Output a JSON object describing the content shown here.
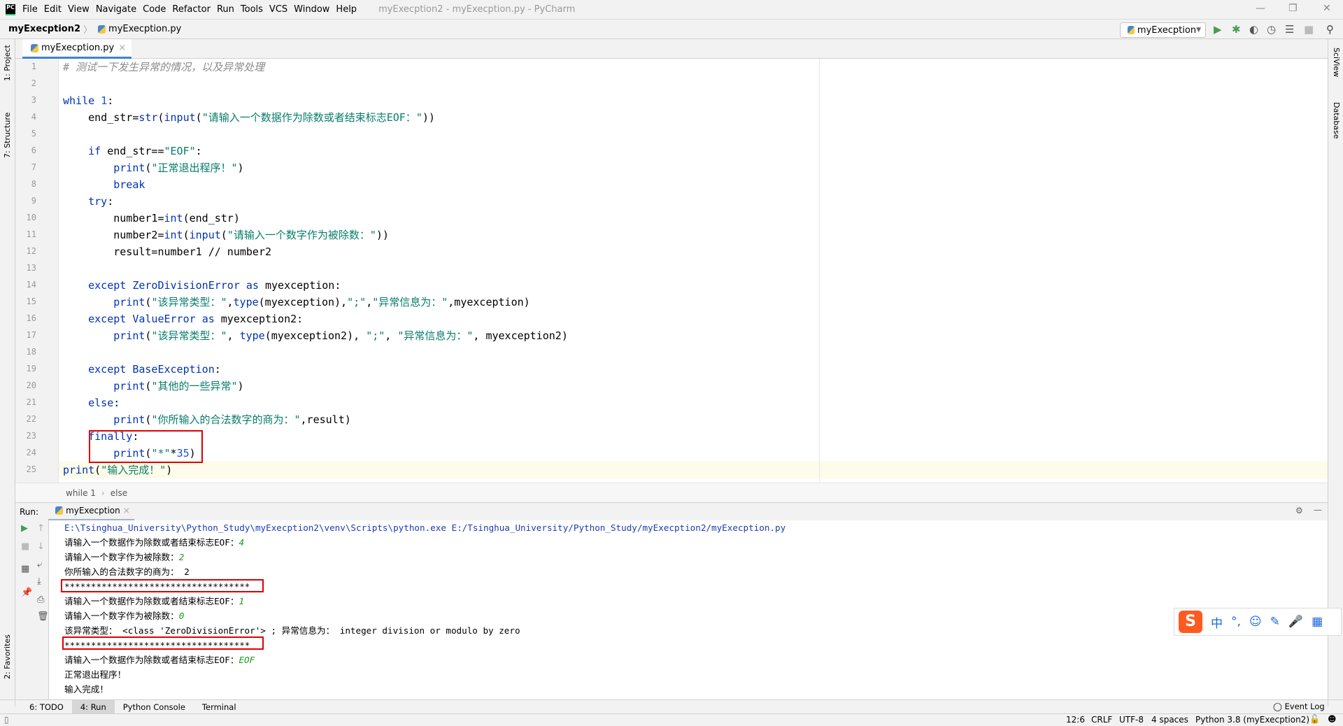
{
  "window": {
    "title": "myExecption2 - myExecption.py - PyCharm",
    "controls": [
      "—",
      "❐",
      "✕"
    ]
  },
  "menu": [
    "File",
    "Edit",
    "View",
    "Navigate",
    "Code",
    "Refactor",
    "Run",
    "Tools",
    "VCS",
    "Window",
    "Help"
  ],
  "nav": {
    "project": "myExecption2",
    "file": "myExecption.py"
  },
  "toolbar": {
    "run_config": "myExecption",
    "icons": [
      "run-icon",
      "debug-icon",
      "coverage-icon",
      "profile-icon",
      "concurrency-icon",
      "stop-icon",
      "search-icon"
    ]
  },
  "editor_tab": {
    "label": "myExecption.py"
  },
  "left_strip": {
    "project": "1: Project",
    "structure": "7: Structure",
    "favorites": "2: Favorites"
  },
  "right_strip": {
    "sciview": "SciView",
    "database": "Database"
  },
  "code": [
    [
      [
        "# 测试一下发生异常的情况，以及异常处理",
        "cm"
      ]
    ],
    [],
    [
      [
        "while ",
        "kw"
      ],
      [
        "1",
        "nm"
      ],
      [
        ":",
        "pl"
      ]
    ],
    [
      [
        "    end_str=",
        "pl"
      ],
      [
        "str",
        "bi"
      ],
      [
        "(",
        "pl"
      ],
      [
        "input",
        "bi"
      ],
      [
        "(",
        "pl"
      ],
      [
        "\"请输入一个数据作为除数或者结束标志EOF：\"",
        "st"
      ],
      [
        "))",
        "pl"
      ]
    ],
    [],
    [
      [
        "    ",
        "pl"
      ],
      [
        "if ",
        "kw"
      ],
      [
        "end_str==",
        "pl"
      ],
      [
        "\"EOF\"",
        "st"
      ],
      [
        ":",
        "pl"
      ]
    ],
    [
      [
        "        ",
        "pl"
      ],
      [
        "print",
        "bi"
      ],
      [
        "(",
        "pl"
      ],
      [
        "\"正常退出程序！\"",
        "st"
      ],
      [
        ")",
        "pl"
      ]
    ],
    [
      [
        "        ",
        "pl"
      ],
      [
        "break",
        "kw"
      ]
    ],
    [
      [
        "    ",
        "pl"
      ],
      [
        "try",
        "kw"
      ],
      [
        ":",
        "pl"
      ]
    ],
    [
      [
        "        number1=",
        "pl"
      ],
      [
        "int",
        "bi"
      ],
      [
        "(end_str)",
        "pl"
      ]
    ],
    [
      [
        "        number2=",
        "pl"
      ],
      [
        "int",
        "bi"
      ],
      [
        "(",
        "pl"
      ],
      [
        "input",
        "bi"
      ],
      [
        "(",
        "pl"
      ],
      [
        "\"请输入一个数字作为被除数：\"",
        "st"
      ],
      [
        "))",
        "pl"
      ]
    ],
    [
      [
        "        result=number1 // number2",
        "pl"
      ]
    ],
    [],
    [
      [
        "    ",
        "pl"
      ],
      [
        "except ",
        "kw"
      ],
      [
        "ZeroDivisionError ",
        "bi"
      ],
      [
        "as ",
        "kw"
      ],
      [
        "myexception:",
        "pl"
      ]
    ],
    [
      [
        "        ",
        "pl"
      ],
      [
        "print",
        "bi"
      ],
      [
        "(",
        "pl"
      ],
      [
        "\"该异常类型：\"",
        "st"
      ],
      [
        ",",
        "pl"
      ],
      [
        "type",
        "bi"
      ],
      [
        "(myexception),",
        "pl"
      ],
      [
        "\";\"",
        "st"
      ],
      [
        ",",
        "pl"
      ],
      [
        "\"异常信息为：\"",
        "st"
      ],
      [
        ",myexception)",
        "pl"
      ]
    ],
    [
      [
        "    ",
        "pl"
      ],
      [
        "except ",
        "kw"
      ],
      [
        "ValueError ",
        "bi"
      ],
      [
        "as ",
        "kw"
      ],
      [
        "myexception2:",
        "pl"
      ]
    ],
    [
      [
        "        ",
        "pl"
      ],
      [
        "print",
        "bi"
      ],
      [
        "(",
        "pl"
      ],
      [
        "\"该异常类型：\"",
        "st"
      ],
      [
        ", ",
        "pl"
      ],
      [
        "type",
        "bi"
      ],
      [
        "(myexception2), ",
        "pl"
      ],
      [
        "\";\"",
        "st"
      ],
      [
        ", ",
        "pl"
      ],
      [
        "\"异常信息为：\"",
        "st"
      ],
      [
        ", myexception2)",
        "pl"
      ]
    ],
    [],
    [
      [
        "    ",
        "pl"
      ],
      [
        "except ",
        "kw"
      ],
      [
        "BaseException",
        "bi"
      ],
      [
        ":",
        "pl"
      ]
    ],
    [
      [
        "        ",
        "pl"
      ],
      [
        "print",
        "bi"
      ],
      [
        "(",
        "pl"
      ],
      [
        "\"其他的一些异常\"",
        "st"
      ],
      [
        ")",
        "pl"
      ]
    ],
    [
      [
        "    ",
        "pl"
      ],
      [
        "else",
        "kw"
      ],
      [
        ":",
        "pl"
      ]
    ],
    [
      [
        "        ",
        "pl"
      ],
      [
        "print",
        "bi"
      ],
      [
        "(",
        "pl"
      ],
      [
        "\"你所输入的合法数字的商为：\"",
        "st"
      ],
      [
        ",result)",
        "pl"
      ]
    ],
    [
      [
        "    ",
        "pl"
      ],
      [
        "finally",
        "kw"
      ],
      [
        ":",
        "pl"
      ]
    ],
    [
      [
        "        ",
        "pl"
      ],
      [
        "print",
        "bi"
      ],
      [
        "(",
        "pl"
      ],
      [
        "\"*\"",
        "st"
      ],
      [
        "*",
        "pl"
      ],
      [
        "35",
        "nm"
      ],
      [
        ")",
        "pl"
      ]
    ],
    [
      [
        "print",
        "bi"
      ],
      [
        "(",
        "pl"
      ],
      [
        "\"输入完成！\"",
        "st"
      ],
      [
        ")",
        "pl"
      ]
    ]
  ],
  "breadcrumb": [
    "while 1",
    "else"
  ],
  "run": {
    "label": "Run:",
    "tab": "myExecption",
    "output": [
      {
        "t": "E:\\Tsinghua_University\\Python_Study\\myExecption2\\venv\\Scripts\\python.exe E:/Tsinghua_University/Python_Study/myExecption2/myExecption.py",
        "c": "path"
      },
      {
        "t": "请输入一个数据作为除数或者结束标志EOF：",
        "in": "4"
      },
      {
        "t": "请输入一个数字作为被除数：",
        "in": "2"
      },
      {
        "t": "你所输入的合法数字的商为： 2"
      },
      {
        "t": "***********************************"
      },
      {
        "t": "请输入一个数据作为除数或者结束标志EOF：",
        "in": "1"
      },
      {
        "t": "请输入一个数字作为被除数：",
        "in": "0"
      },
      {
        "t": "该异常类型： <class 'ZeroDivisionError'> ; 异常信息为： integer division or modulo by zero"
      },
      {
        "t": "***********************************"
      },
      {
        "t": "请输入一个数据作为除数或者结束标志EOF：",
        "in": "EOF"
      },
      {
        "t": "正常退出程序！"
      },
      {
        "t": "输入完成！"
      }
    ]
  },
  "bottom_tabs": [
    "6: TODO",
    "4: Run",
    "Python Console",
    "Terminal"
  ],
  "event_log": "Event Log",
  "status": {
    "position": "12:6",
    "line_sep": "CRLF",
    "encoding": "UTF-8",
    "indent": "4 spaces",
    "interpreter": "Python 3.8 (myExecption2)"
  },
  "ime": {
    "logo": "S",
    "lang": "中"
  },
  "colors": {
    "keyword": "#0033b3",
    "string": "#067d6b",
    "comment": "#8c8c8c",
    "highlight_box": "#e00000",
    "run_green": "#499c54"
  }
}
